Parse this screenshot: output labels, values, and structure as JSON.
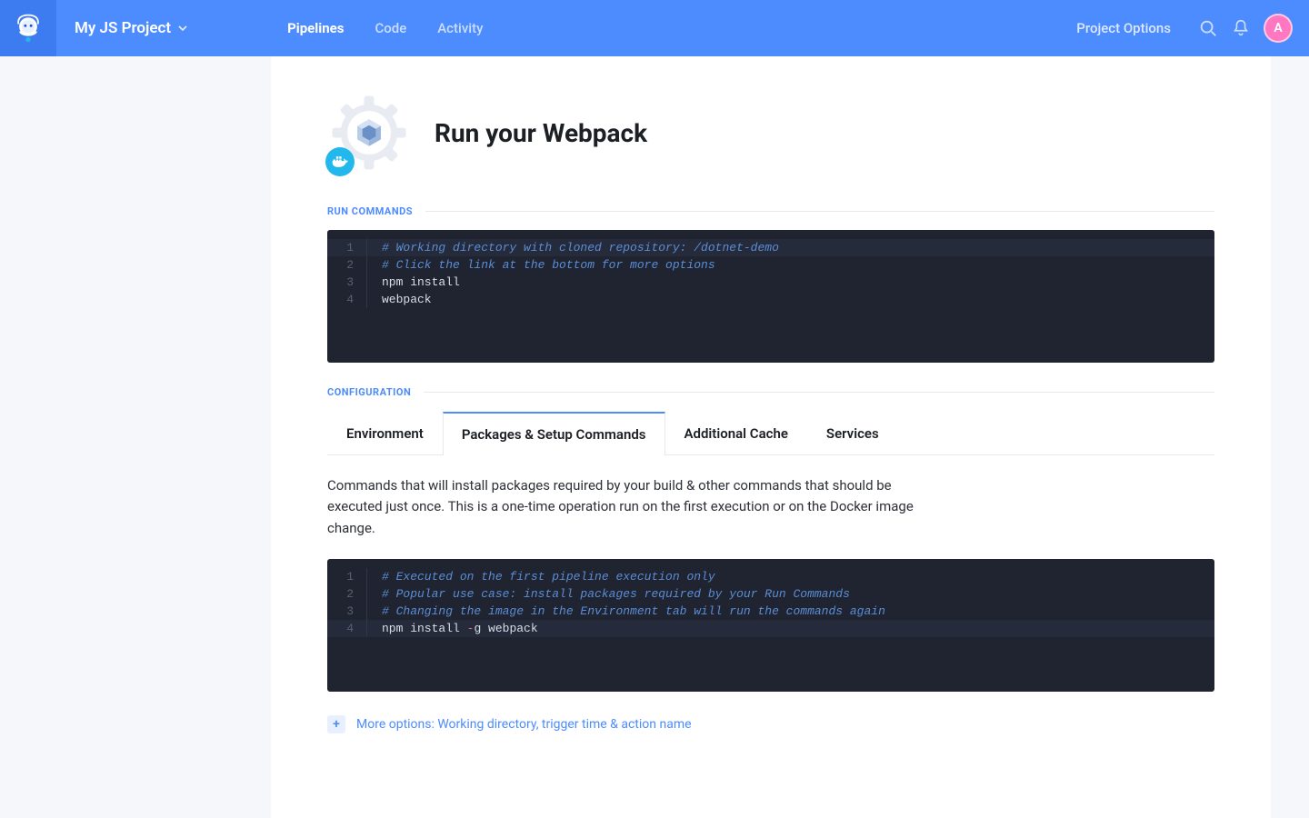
{
  "header": {
    "project_name": "My JS Project",
    "nav": [
      {
        "label": "Pipelines",
        "active": true
      },
      {
        "label": "Code",
        "active": false
      },
      {
        "label": "Activity",
        "active": false
      }
    ],
    "project_options": "Project Options",
    "avatar_letter": "A"
  },
  "page": {
    "title": "Run your Webpack",
    "run_commands_label": "RUN COMMANDS",
    "configuration_label": "CONFIGURATION"
  },
  "run_commands_editor": {
    "lines": [
      {
        "n": "1",
        "text": "# Working directory with cloned repository: /dotnet-demo",
        "type": "comment",
        "hl": true
      },
      {
        "n": "2",
        "text": "# Click the link at the bottom for more options",
        "type": "comment",
        "hl": false
      },
      {
        "n": "3",
        "text": "npm install",
        "type": "plain",
        "hl": false
      },
      {
        "n": "4",
        "text": "webpack",
        "type": "plain",
        "hl": false
      }
    ]
  },
  "config_tabs": [
    {
      "label": "Environment",
      "active": false
    },
    {
      "label": "Packages & Setup Commands",
      "active": true
    },
    {
      "label": "Additional Cache",
      "active": false
    },
    {
      "label": "Services",
      "active": false
    }
  ],
  "config_description": "Commands that will install packages required by your build & other commands that should be executed just once. This is a one-time operation run on the first execution or on the Docker image change.",
  "setup_commands_editor": {
    "lines": [
      {
        "n": "1",
        "text": "# Executed on the first pipeline execution only",
        "type": "comment",
        "hl": false
      },
      {
        "n": "2",
        "text": "# Popular use case: install packages required by your Run Commands",
        "type": "comment",
        "hl": false
      },
      {
        "n": "3",
        "text": "# Changing the image in the Environment tab will run the commands again",
        "type": "comment",
        "hl": false
      },
      {
        "n": "4",
        "text_pre": "npm install ",
        "op": "-",
        "text_post": "g webpack",
        "type": "cmd-op",
        "hl": true
      }
    ]
  },
  "more_options": {
    "label": "More options: Working directory, trigger time & action name"
  }
}
